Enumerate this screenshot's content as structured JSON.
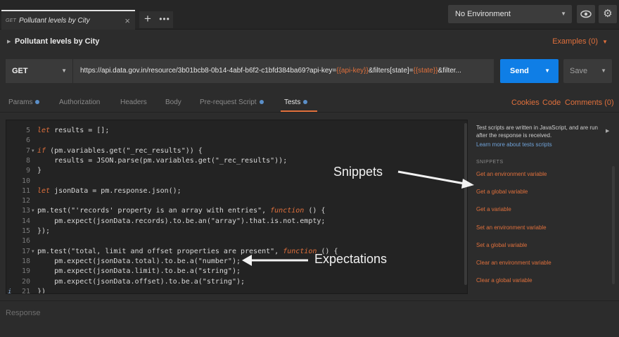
{
  "topbar": {
    "tab": {
      "method": "GET",
      "name": "Pollutant levels by City",
      "close": "×"
    },
    "new_tab": "+",
    "more": "•••",
    "environment": "No Environment",
    "settings_icon": "gear-icon",
    "eye_icon": "eye-icon"
  },
  "request": {
    "name": "Pollutant levels by City",
    "examples": "Examples (0)"
  },
  "urlbar": {
    "method": "GET",
    "url_prefix": "https://api.data.gov.in/resource/3b01bcb8-0b14-4abf-b6f2-c1bfd384ba69?api-key=",
    "var_key": "{{api-key}}",
    "url_mid": "&filters[state]=",
    "var_state": "{{state}}",
    "url_suffix": "&filter...",
    "send": "Send",
    "save": "Save"
  },
  "subtabs": {
    "params": "Params",
    "authorization": "Authorization",
    "headers": "Headers",
    "body": "Body",
    "prerequest": "Pre-request Script",
    "tests": "Tests",
    "cookies": "Cookies",
    "code": "Code",
    "comments": "Comments (0)"
  },
  "code_lines": [
    {
      "n": "5",
      "parts": [
        [
          "kw",
          "let"
        ],
        [
          "t",
          " results = [];"
        ]
      ]
    },
    {
      "n": "6",
      "parts": []
    },
    {
      "n": "7",
      "fold": true,
      "parts": [
        [
          "kw",
          "if"
        ],
        [
          "t",
          " (pm.variables.get(\"_rec_results\")) {"
        ]
      ]
    },
    {
      "n": "8",
      "parts": [
        [
          "t",
          "    results = JSON.parse(pm.variables.get(\"_rec_results\"));"
        ]
      ]
    },
    {
      "n": "9",
      "parts": [
        [
          "t",
          "}"
        ]
      ]
    },
    {
      "n": "10",
      "parts": []
    },
    {
      "n": "11",
      "parts": [
        [
          "kw",
          "let"
        ],
        [
          "t",
          " jsonData = pm.response.json();"
        ]
      ]
    },
    {
      "n": "12",
      "parts": []
    },
    {
      "n": "13",
      "fold": true,
      "parts": [
        [
          "t",
          "pm.test(\"'records' property is an array with entries\", "
        ],
        [
          "kw",
          "function"
        ],
        [
          "t",
          " () {"
        ]
      ]
    },
    {
      "n": "14",
      "parts": [
        [
          "t",
          "    pm.expect(jsonData.records).to.be.an(\"array\").that.is.not.empty;"
        ]
      ]
    },
    {
      "n": "15",
      "parts": [
        [
          "t",
          "});"
        ]
      ]
    },
    {
      "n": "16",
      "parts": []
    },
    {
      "n": "17",
      "fold": true,
      "parts": [
        [
          "t",
          "pm.test(\"total, limit and offset properties are present\", "
        ],
        [
          "kw",
          "function"
        ],
        [
          "t",
          " () {"
        ]
      ]
    },
    {
      "n": "18",
      "parts": [
        [
          "t",
          "    pm.expect(jsonData.total).to.be.a(\"number\");"
        ]
      ]
    },
    {
      "n": "19",
      "parts": [
        [
          "t",
          "    pm.expect(jsonData.limit).to.be.a(\"string\");"
        ]
      ]
    },
    {
      "n": "20",
      "parts": [
        [
          "t",
          "    pm.expect(jsonData.offset).to.be.a(\"string\");"
        ]
      ]
    },
    {
      "n": "21",
      "warn": true,
      "parts": [
        [
          "t",
          "})"
        ]
      ]
    }
  ],
  "sidebar": {
    "description": "Test scripts are written in JavaScript, and are run after the response is received.",
    "learn_more": "Learn more about tests scripts",
    "snippets_heading": "SNIPPETS",
    "snippets": [
      "Get an environment variable",
      "Get a global variable",
      "Get a variable",
      "Set an environment variable",
      "Set a global variable",
      "Clear an environment variable",
      "Clear a global variable"
    ]
  },
  "annotations": {
    "snippets": "Snippets",
    "expectations": "Expectations"
  },
  "response": {
    "label": "Response"
  }
}
